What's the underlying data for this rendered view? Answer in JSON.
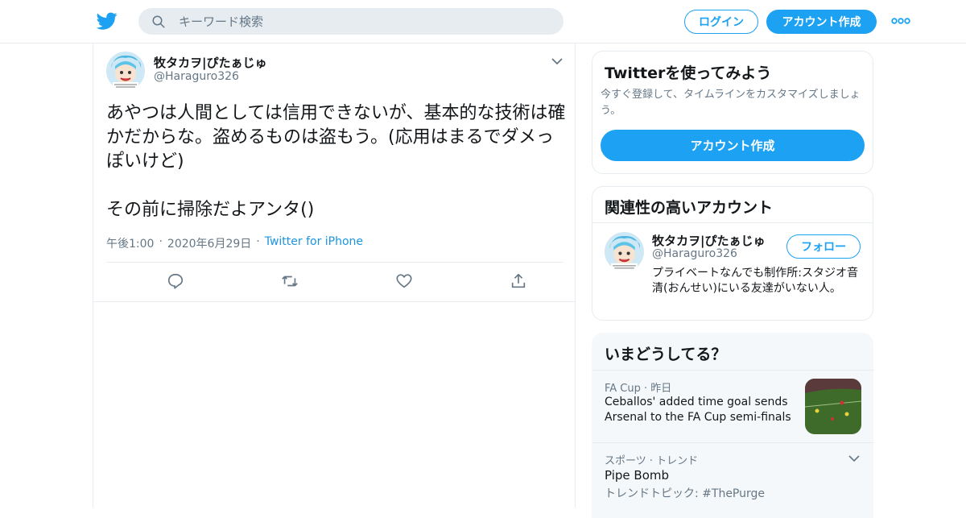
{
  "header": {
    "search_placeholder": "キーワード検索",
    "login_label": "ログイン",
    "signup_label": "アカウント作成"
  },
  "tweet": {
    "author_name": "牧タカヲ|ぴたぁじゅ",
    "author_handle": "@Haraguro326",
    "text": "あやつは人間としては信用できないが、基本的な技術は確かだからな。盗めるものは盗もう。(応用はまるでダメっぽいけど)\n\nその前に掃除だよアンタ()",
    "time": "午後1:00",
    "date": "2020年6月29日",
    "source": "Twitter for iPhone"
  },
  "signup_card": {
    "title": "Twitterを使ってみよう",
    "description": "今すぐ登録して、タイムラインをカスタマイズしましょう。",
    "button_label": "アカウント作成"
  },
  "related": {
    "title": "関連性の高いアカウント",
    "name": "牧タカヲ|ぴたぁじゅ",
    "handle": "@Haraguro326",
    "follow_label": "フォロー",
    "bio": "プライベートなんでも制作所:スタジオ音清(おんせい)にいる友達がいない人。"
  },
  "trends": {
    "title": "いまどうしてる？",
    "items": [
      {
        "meta": "FA Cup · 昨日",
        "title": "Ceballos' added time goal sends Arsenal to the FA Cup semi-finals"
      },
      {
        "meta": "スポーツ · トレンド",
        "title": "Pipe Bomb",
        "sub": "トレンドトピック: #ThePurge"
      }
    ]
  },
  "colors": {
    "accent": "#1da1f2",
    "muted": "#657786",
    "border": "#e6ecf0"
  },
  "icons": [
    "twitter-logo-icon",
    "search-icon",
    "more-icon",
    "chevron-down-icon",
    "reply-icon",
    "retweet-icon",
    "like-icon",
    "share-icon"
  ]
}
